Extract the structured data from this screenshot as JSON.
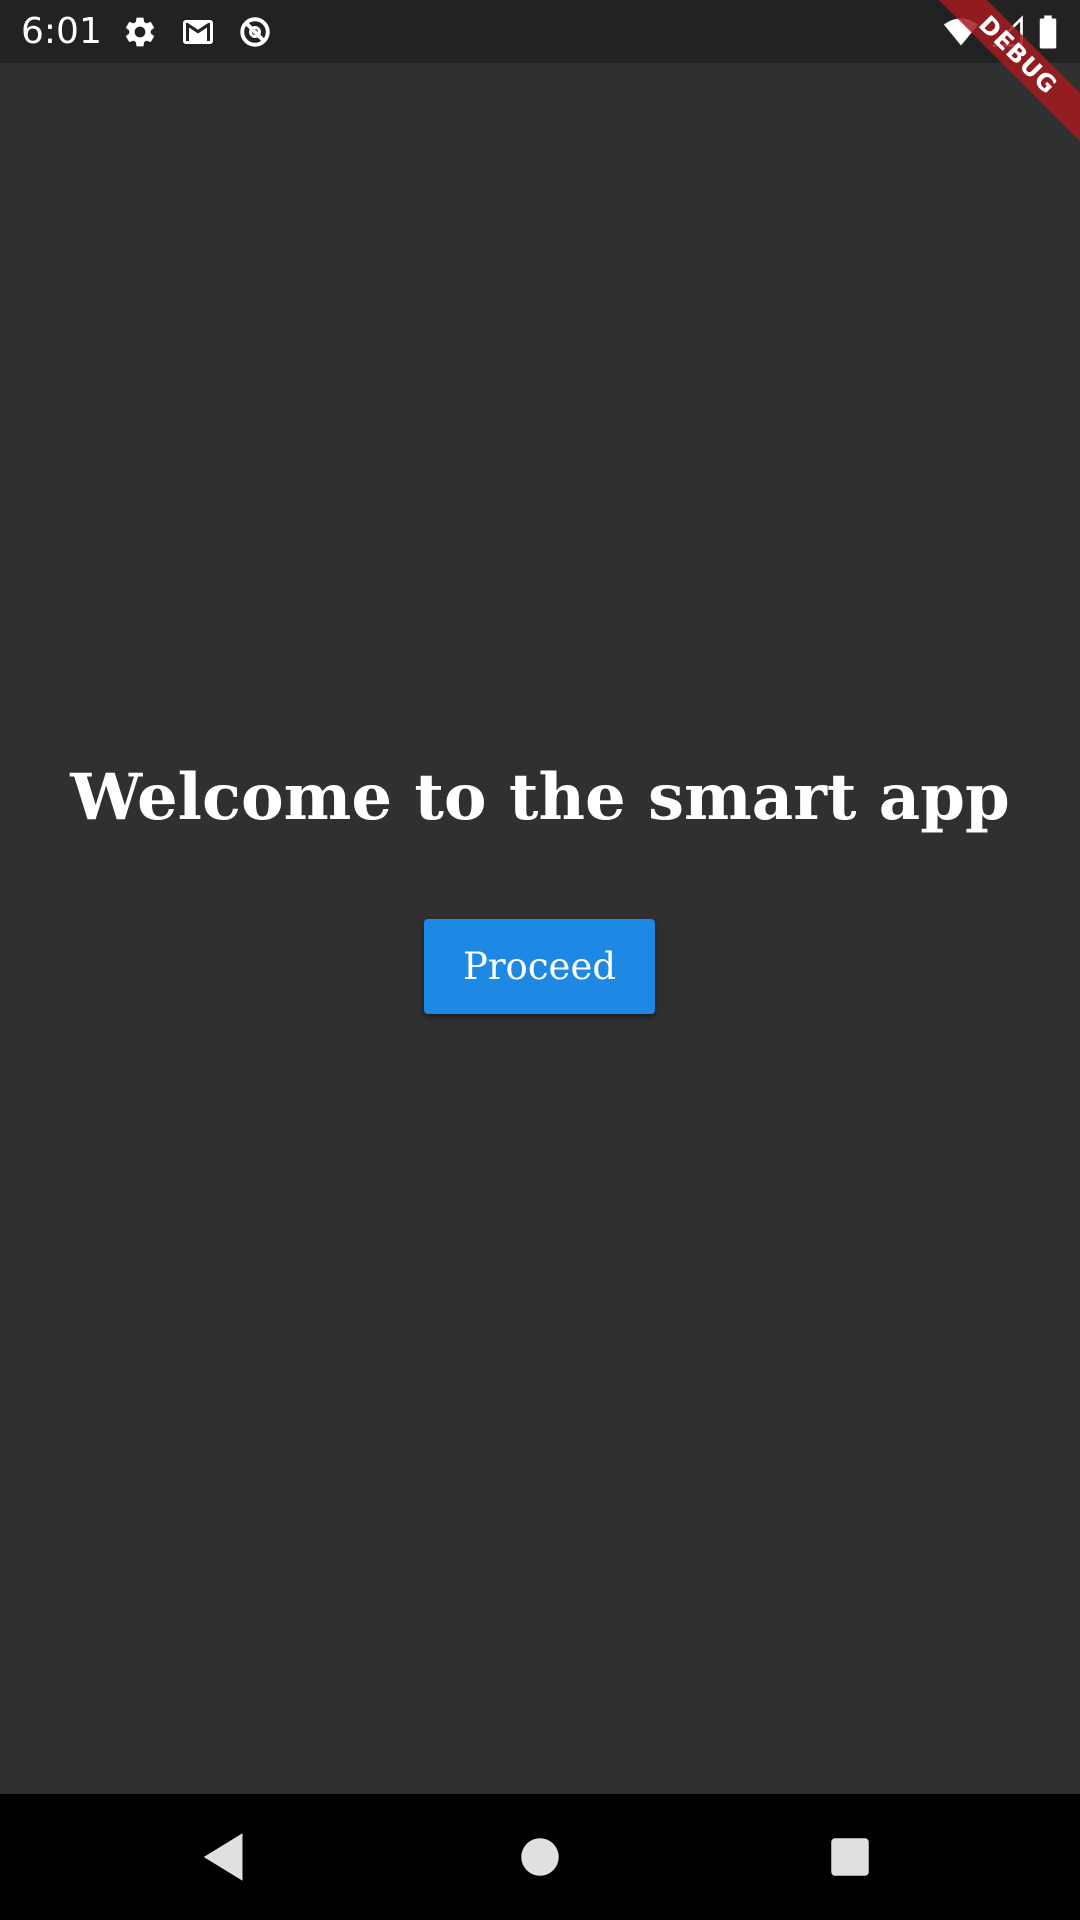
{
  "status_bar": {
    "time": "6:01",
    "icons_left": [
      "settings-icon",
      "gmail-icon",
      "data-saver-icon"
    ],
    "icons_right": [
      "wifi-icon",
      "cell-signal-icon",
      "battery-icon"
    ]
  },
  "debug_banner": {
    "label": "DEBUG",
    "color": "#a51b20"
  },
  "main": {
    "title": "Welcome to the smart app",
    "proceed_label": "Proceed",
    "background": "#303030",
    "button_color": "#1e88e5"
  },
  "nav_bar": {
    "buttons": [
      "back-icon",
      "home-icon",
      "recents-icon"
    ]
  }
}
